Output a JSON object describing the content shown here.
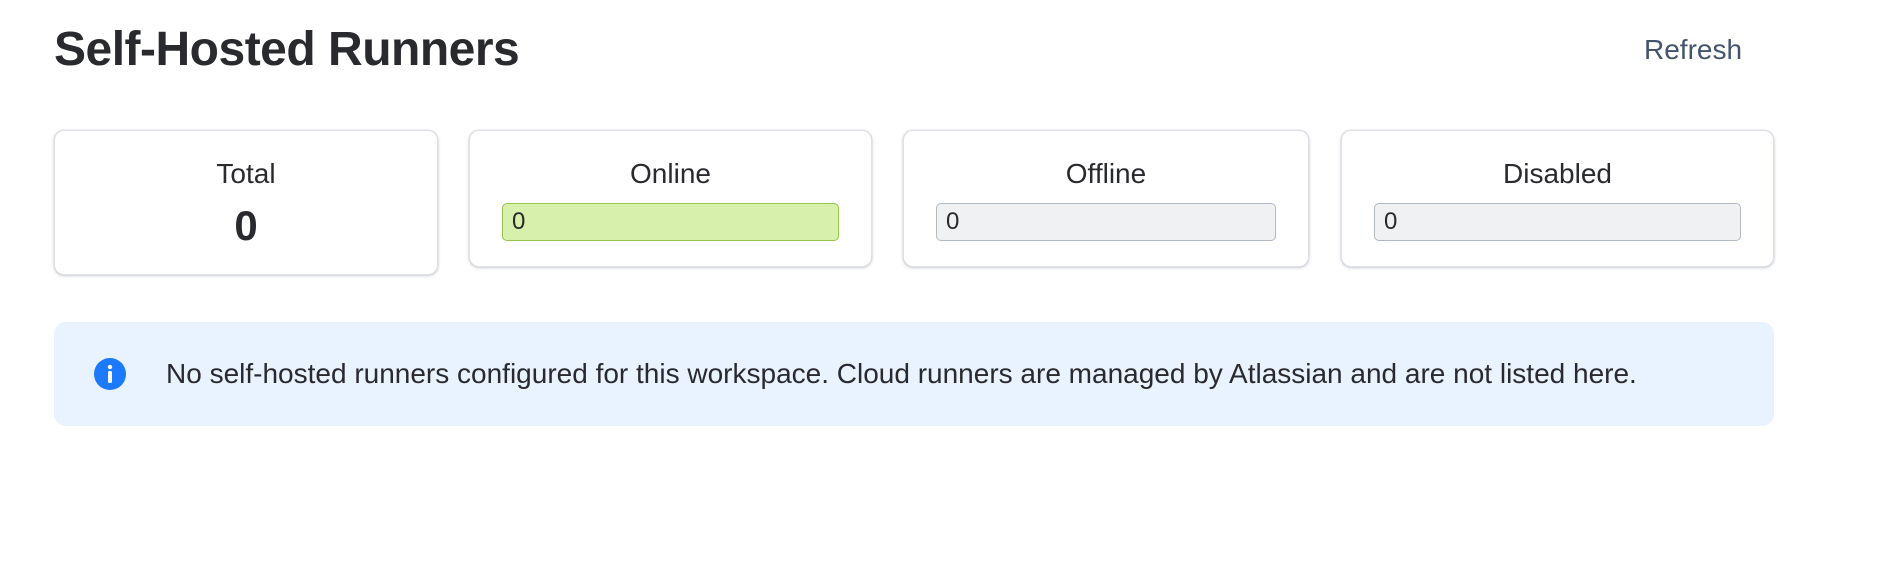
{
  "header": {
    "title": "Self-Hosted Runners",
    "refresh_label": "Refresh"
  },
  "stats": {
    "total": {
      "label": "Total",
      "value": "0"
    },
    "online": {
      "label": "Online",
      "value": "0"
    },
    "offline": {
      "label": "Offline",
      "value": "0"
    },
    "disabled": {
      "label": "Disabled",
      "value": "0"
    }
  },
  "info_banner": {
    "icon": "info-icon",
    "message": "No self-hosted runners configured for this workspace. Cloud runners are managed by Atlassian and are not listed here."
  },
  "colors": {
    "online_fill": "#d7f0ab",
    "online_border": "#94c748",
    "neutral_fill": "#f0f1f2",
    "banner_background": "#e9f2ff",
    "info_icon": "#1d7afc"
  }
}
